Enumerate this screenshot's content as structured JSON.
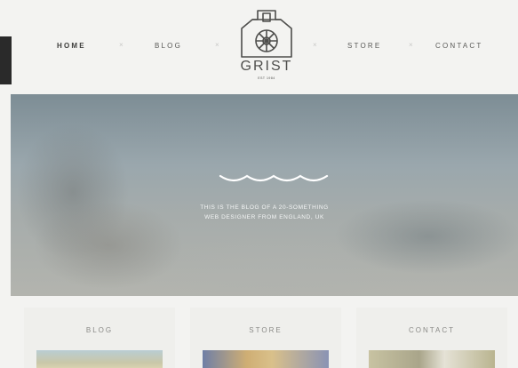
{
  "nav": {
    "home": "HOME",
    "blog": "BLOG",
    "store": "STORE",
    "contact": "CONTACT",
    "separator": "×"
  },
  "logo": {
    "word": "GRIST",
    "sub": "EST 1984"
  },
  "hero": {
    "line1": "THIS IS THE BLOG OF A 20-SOMETHING",
    "line2": "WEB DESIGNER FROM ENGLAND, UK"
  },
  "cards": [
    {
      "title": "BLOG"
    },
    {
      "title": "STORE"
    },
    {
      "title": "CONTACT"
    }
  ],
  "colors": {
    "background": "#f3f3f1",
    "text": "#4a4a48",
    "hero": "#9aa7ad"
  }
}
